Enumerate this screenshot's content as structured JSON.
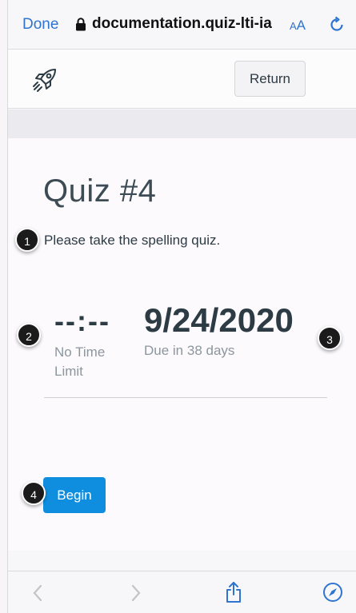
{
  "browser": {
    "done_label": "Done",
    "url": "documentation.quiz-lti-ia",
    "text_size_label_small": "A",
    "text_size_label_large": "A"
  },
  "header": {
    "return_label": "Return"
  },
  "quiz": {
    "title": "Quiz #4",
    "description": "Please take the spelling quiz.",
    "time_value": "--:--",
    "time_label": "No Time Limit",
    "due_date": "9/24/2020",
    "due_label": "Due in 38 days",
    "begin_label": "Begin"
  },
  "markers": [
    "1",
    "2",
    "3",
    "4"
  ],
  "colors": {
    "accent": "#2f74d0",
    "begin_button": "#0f8ee0",
    "text": "#2d3b45",
    "muted": "#8b969e"
  },
  "icons": {
    "lock": "lock-icon",
    "reload": "reload-icon",
    "rocket": "rocket-icon",
    "back": "chevron-left-icon",
    "forward": "chevron-right-icon",
    "share": "share-icon",
    "compass": "compass-icon"
  }
}
